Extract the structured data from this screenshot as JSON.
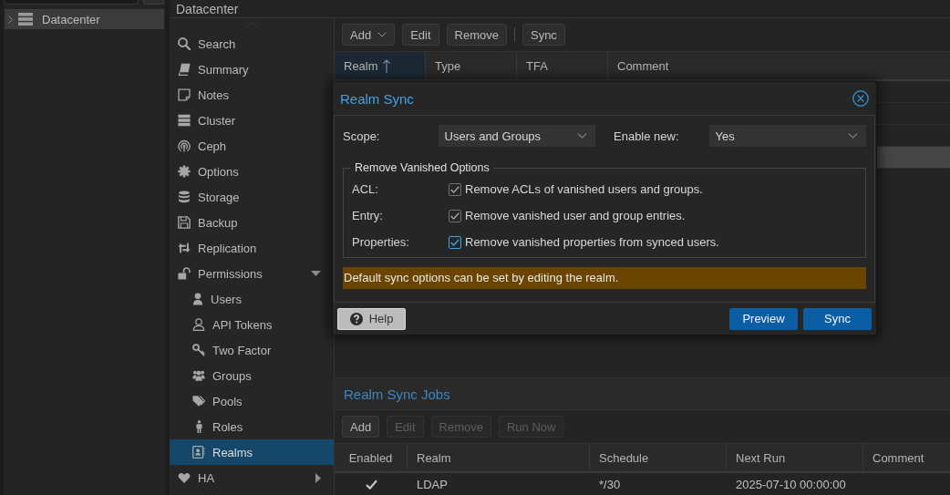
{
  "tree_panel": {
    "items": [
      {
        "label": "Datacenter",
        "selected": true,
        "expanded": false
      }
    ]
  },
  "header": {
    "title": "Datacenter"
  },
  "nav": {
    "items": [
      {
        "label": "Search",
        "selected": false
      },
      {
        "label": "Summary",
        "selected": false
      },
      {
        "label": "Notes",
        "selected": false
      },
      {
        "label": "Cluster",
        "selected": false
      },
      {
        "label": "Ceph",
        "selected": false
      },
      {
        "label": "Options",
        "selected": false
      },
      {
        "label": "Storage",
        "selected": false
      },
      {
        "label": "Backup",
        "selected": false
      },
      {
        "label": "Replication",
        "selected": false
      },
      {
        "label": "Permissions",
        "selected": false,
        "expanded": true,
        "children": [
          {
            "label": "Users",
            "selected": false
          },
          {
            "label": "API Tokens",
            "selected": false
          },
          {
            "label": "Two Factor",
            "selected": false
          },
          {
            "label": "Groups",
            "selected": false
          },
          {
            "label": "Pools",
            "selected": false
          },
          {
            "label": "Roles",
            "selected": false
          },
          {
            "label": "Realms",
            "selected": true
          }
        ]
      },
      {
        "label": "HA",
        "selected": false,
        "expanded": false
      }
    ]
  },
  "realms": {
    "toolbar": [
      {
        "kind": "menu",
        "label": "Add",
        "disabled": false
      },
      {
        "kind": "button",
        "label": "Edit",
        "disabled": false
      },
      {
        "kind": "button",
        "label": "Remove",
        "disabled": false
      },
      {
        "kind": "separator"
      },
      {
        "kind": "button",
        "label": "Sync",
        "disabled": false
      }
    ],
    "columns": [
      {
        "label": "Realm",
        "sorted": true
      },
      {
        "label": "Type",
        "sorted": false
      },
      {
        "label": "TFA",
        "sorted": false
      },
      {
        "label": "Comment",
        "sorted": false
      }
    ],
    "rows": [
      {
        "selected": false
      },
      {
        "selected": false
      },
      {
        "selected": false
      },
      {
        "selected": true
      }
    ]
  },
  "dialog": {
    "title": "Realm Sync",
    "fields": [
      {
        "label": "Scope:",
        "value": "Users and Groups"
      },
      {
        "label": "Enable new:",
        "value": "Yes"
      }
    ],
    "fieldset": {
      "legend": "Remove Vanished Options",
      "options": [
        {
          "label": "ACL:",
          "text": "Remove ACLs of vanished users and groups.",
          "checked": true,
          "focused": false
        },
        {
          "label": "Entry:",
          "text": "Remove vanished user and group entries.",
          "checked": true,
          "focused": false
        },
        {
          "label": "Properties:",
          "text": "Remove vanished properties from synced users.",
          "checked": true,
          "focused": true
        }
      ]
    },
    "notice": "Default sync options can be set by editing the realm.",
    "buttons": [
      {
        "kind": "help",
        "label": "Help"
      },
      {
        "kind": "primary",
        "label": "Preview"
      },
      {
        "kind": "primary",
        "label": "Sync"
      }
    ]
  },
  "sync_jobs": {
    "title": "Realm Sync Jobs",
    "toolbar": [
      {
        "kind": "button",
        "label": "Add",
        "disabled": false
      },
      {
        "kind": "button",
        "label": "Edit",
        "disabled": true
      },
      {
        "kind": "button",
        "label": "Remove",
        "disabled": true
      },
      {
        "kind": "button",
        "label": "Run Now",
        "disabled": true
      }
    ],
    "columns": [
      "Enabled",
      "Realm",
      "Schedule",
      "Next Run",
      "Comment"
    ],
    "rows": [
      {
        "enabled": true,
        "realm": "LDAP",
        "schedule": "*/30",
        "next_run": "2025-07-10 00:00:00"
      }
    ]
  }
}
